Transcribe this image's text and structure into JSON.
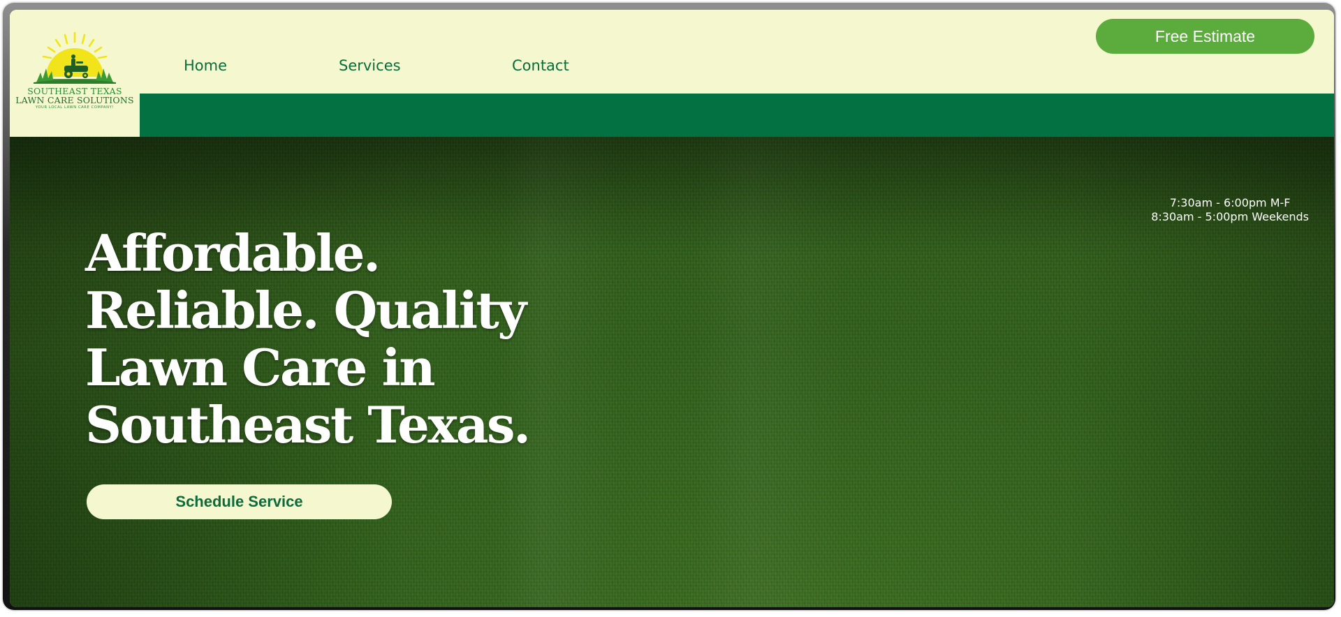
{
  "logo": {
    "line1": "SOUTHEAST TEXAS",
    "line2": "LAWN CARE SOLUTIONS",
    "line3": "YOUR LOCAL LAWN CARE COMPANY!"
  },
  "nav": {
    "items": [
      {
        "label": "Home"
      },
      {
        "label": "Services"
      },
      {
        "label": "Contact"
      }
    ]
  },
  "header": {
    "cta_label": "Free Estimate"
  },
  "hero": {
    "hours": [
      "7:30am - 6:00pm M-F",
      "8:30am - 5:00pm Weekends"
    ],
    "headline_lines": [
      "Affordable.",
      "Reliable. Quality",
      "Lawn Care in",
      "Southeast Texas."
    ],
    "cta_label": "Schedule Service"
  },
  "colors": {
    "cream": "#f5f8ce",
    "forest_green": "#047142",
    "nav_text": "#0b6b3a",
    "button_green": "#5bab3d",
    "sun_yellow": "#f2e41b"
  }
}
